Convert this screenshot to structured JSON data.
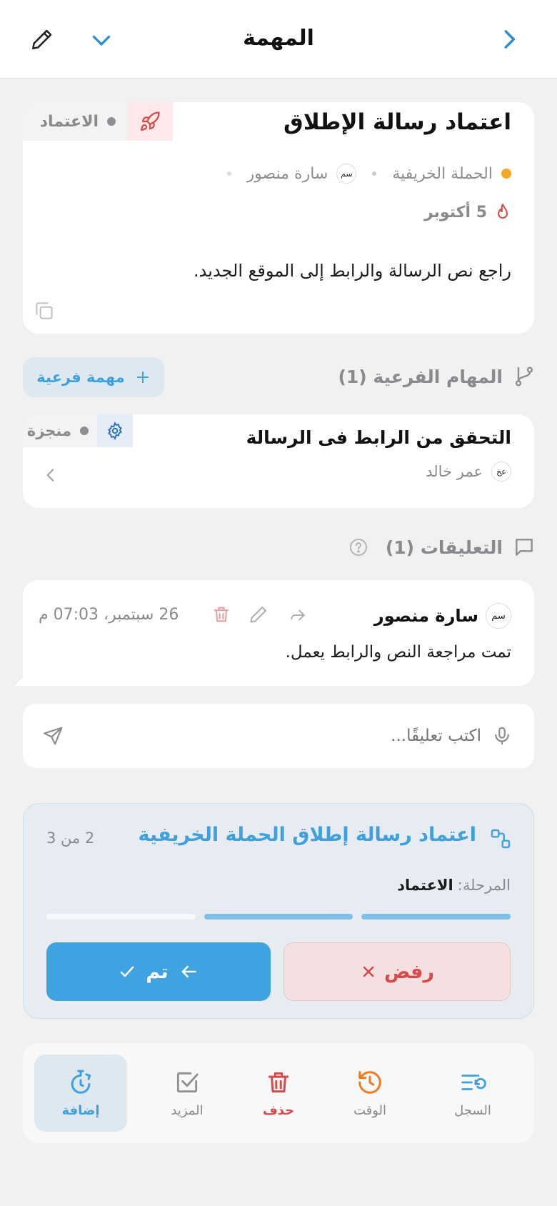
{
  "header": {
    "title": "المهمة"
  },
  "task": {
    "title": "اعتماد رسالة الإطلاق",
    "status": "الاعتماد",
    "project": "الحملة الخريفية",
    "assignee_initials": "سم",
    "assignee": "سارة منصور",
    "due_date": "5 أكتوبر",
    "description": "راجع نص الرسالة والرابط إلى الموقع الجديد."
  },
  "subtasks": {
    "heading": "المهام الفرعية (1)",
    "add_label": "مهمة فرعية",
    "items": [
      {
        "title": "التحقق من الرابط فى الرسالة",
        "status": "منجزة",
        "assignee_initials": "عخ",
        "assignee": "عمر خالد"
      }
    ]
  },
  "comments": {
    "heading": "التعليقات (1)",
    "items": [
      {
        "author_initials": "سم",
        "author": "سارة منصور",
        "time": "26 سبتمبر، 07:03 م",
        "text": "تمت مراجعة النص والرابط يعمل."
      }
    ],
    "input_placeholder": "اكتب تعليقًا..."
  },
  "workflow": {
    "title": "اعتماد رسالة إطلاق الحملة الخريفية",
    "counter": "2 من 3",
    "stage_label": "المرحلة:",
    "stage_value": "الاعتماد",
    "steps_done": 2,
    "steps_total": 3,
    "reject_label": "رفض",
    "done_label": "تم"
  },
  "bottom_bar": {
    "items": [
      {
        "label": "السجل",
        "icon": "log-icon"
      },
      {
        "label": "الوقت",
        "icon": "history-icon"
      },
      {
        "label": "حذف",
        "icon": "trash-icon"
      },
      {
        "label": "المزيد",
        "icon": "checkbox-icon"
      },
      {
        "label": "إضافة",
        "icon": "timer-add-icon"
      }
    ]
  },
  "colors": {
    "accent": "#3ea0de",
    "danger": "#d74a4a",
    "warning": "#ee7d22",
    "project_dot": "#f5a623"
  }
}
